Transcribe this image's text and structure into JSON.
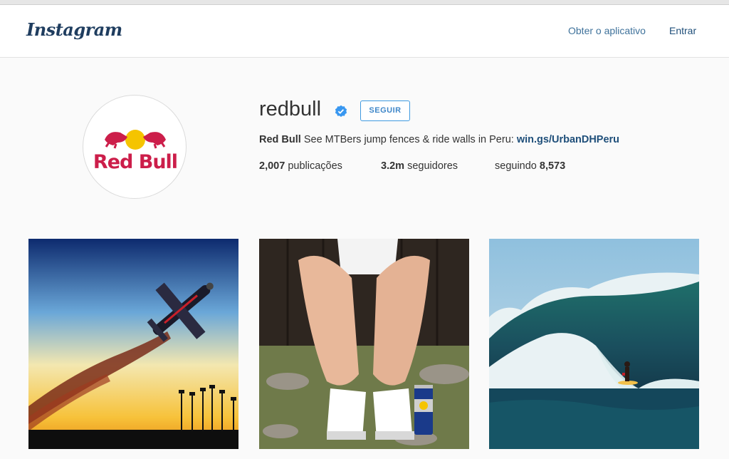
{
  "header": {
    "logo": "Instagram",
    "get_app": "Obter o aplicativo",
    "login": "Entrar"
  },
  "profile": {
    "avatar_text": "Red Bull",
    "username": "redbull",
    "follow_label": "SEGUIR",
    "bio_name": "Red Bull",
    "bio_text": " See MTBers jump fences & ride walls in Peru: ",
    "bio_link": "win.gs/UrbanDHPeru",
    "posts_count": "2,007",
    "posts_label": " publicações",
    "followers_count": "3.2m",
    "followers_label": " seguidores",
    "following_label": "seguindo ",
    "following_count": "8,573"
  },
  "photos": [
    {
      "subject": "stunt-plane"
    },
    {
      "subject": "girl-with-can"
    },
    {
      "subject": "surfer-wave"
    }
  ],
  "colors": {
    "link": "#3f729b",
    "follow_border": "#3f9ae0",
    "redbull_red": "#cc1e4a",
    "redbull_yellow": "#f5c400"
  }
}
